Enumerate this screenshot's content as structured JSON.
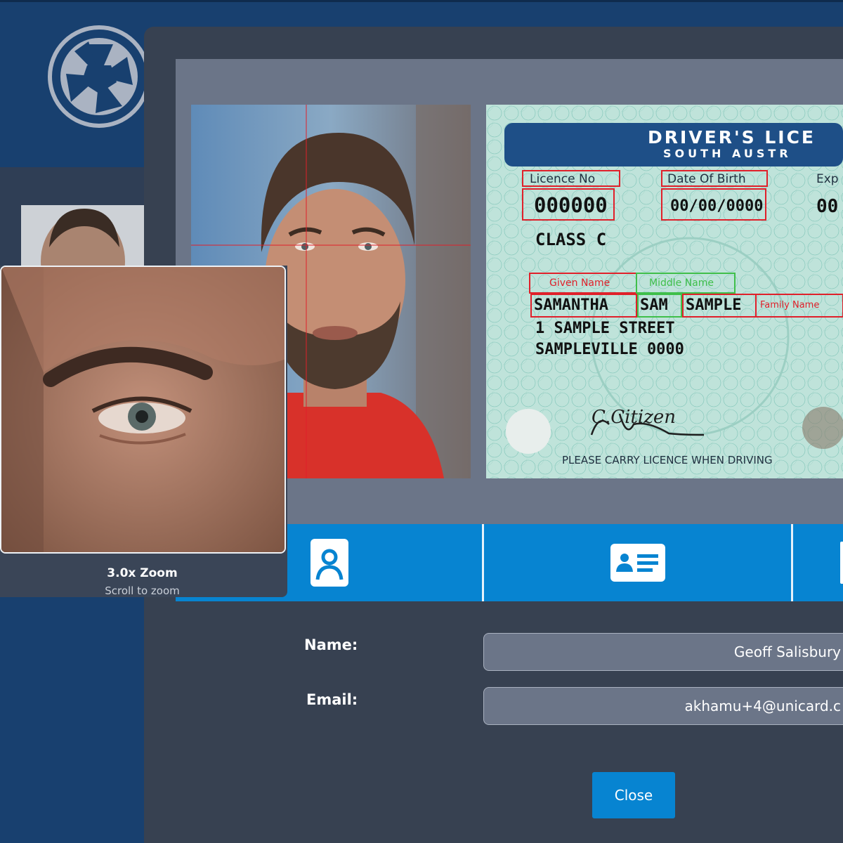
{
  "viewer": {
    "zoom_label": "3.0x Zoom",
    "zoom_hint": "Scroll to zoom"
  },
  "licence": {
    "header_title": "DRIVER'S LICE",
    "header_subtitle": "SOUTH AUSTR",
    "licence_no_label": "Licence No",
    "licence_no": "000000",
    "dob_label": "Date Of Birth",
    "dob": "00/00/0000",
    "expiry_label": "Exp",
    "expiry": "00",
    "class": "CLASS C",
    "given_name_label": "Given Name",
    "middle_name_label": "Middle Name",
    "family_name_label": "Family Name",
    "given_name": "SAMANTHA",
    "middle_name": "SAM",
    "family_name": "SAMPLE",
    "address_line1": "1 SAMPLE STREET",
    "address_line2": "SAMPLEVILLE 0000",
    "footer": "PLEASE CARRY LICENCE WHEN DRIVING",
    "signature_text": "C.Citizen"
  },
  "tabs": [
    {
      "icon": "portrait-icon"
    },
    {
      "icon": "id-card-icon"
    },
    {
      "icon": "document-icon"
    }
  ],
  "form": {
    "name_label": "Name:",
    "name_value": "Geoff Salisbury",
    "email_label": "Email:",
    "email_value": "akhamu+4@unicard.c"
  },
  "close_label": "Close",
  "colors": {
    "header_bg": "#18406f",
    "modal_bg": "#374151",
    "gallery_bg": "#6b7588",
    "accent": "#0784d1",
    "annotation_red": "#e0202a",
    "annotation_green": "#3fbf4a"
  }
}
